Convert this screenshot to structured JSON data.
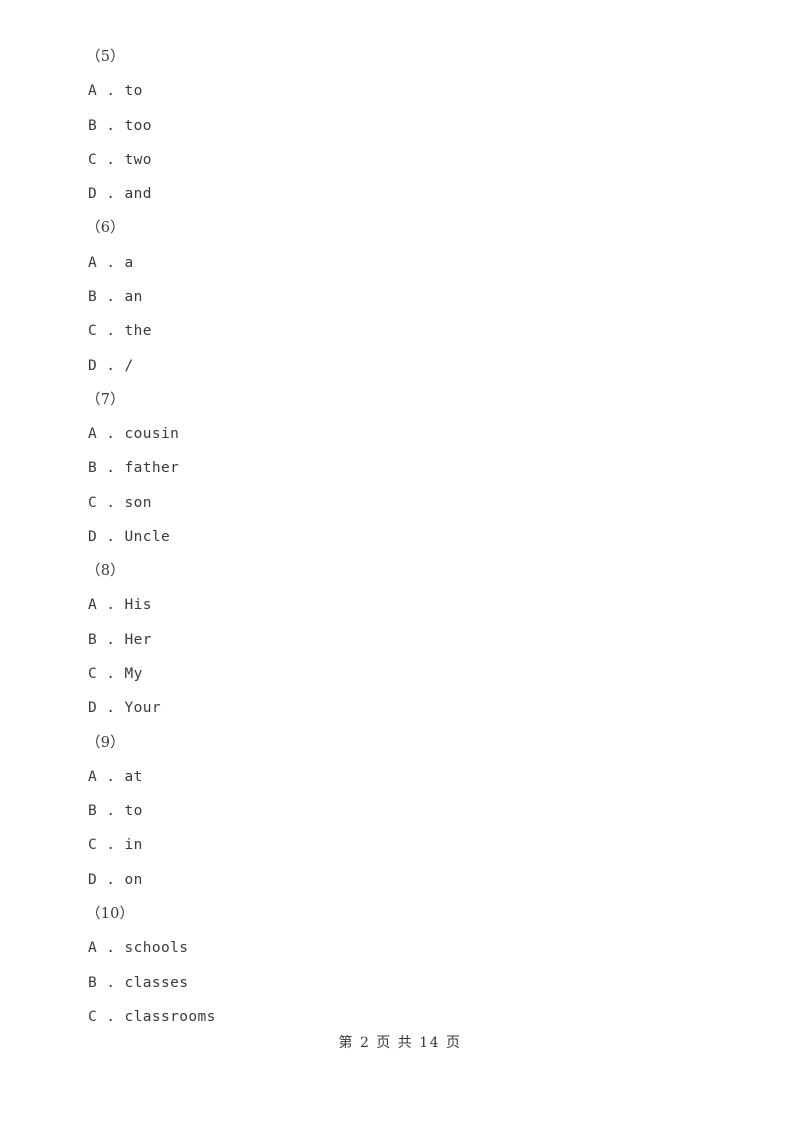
{
  "document": {
    "page_background": "#ffffff",
    "text_color": "#3a3a3a",
    "footer": "第 2 页 共 14 页"
  },
  "questions": [
    {
      "number": "（5）",
      "options": [
        "A . to",
        "B . too",
        "C . two",
        "D . and"
      ]
    },
    {
      "number": "（6）",
      "options": [
        "A . a",
        "B . an",
        "C . the",
        "D . /"
      ]
    },
    {
      "number": "（7）",
      "options": [
        "A . cousin",
        "B . father",
        "C . son",
        "D . Uncle"
      ]
    },
    {
      "number": "（8）",
      "options": [
        "A . His",
        "B . Her",
        "C . My",
        "D . Your"
      ]
    },
    {
      "number": "（9）",
      "options": [
        "A . at",
        "B . to",
        "C . in",
        "D . on"
      ]
    },
    {
      "number": "（10）",
      "options": [
        "A . schools",
        "B . classes",
        "C . classrooms"
      ]
    }
  ]
}
